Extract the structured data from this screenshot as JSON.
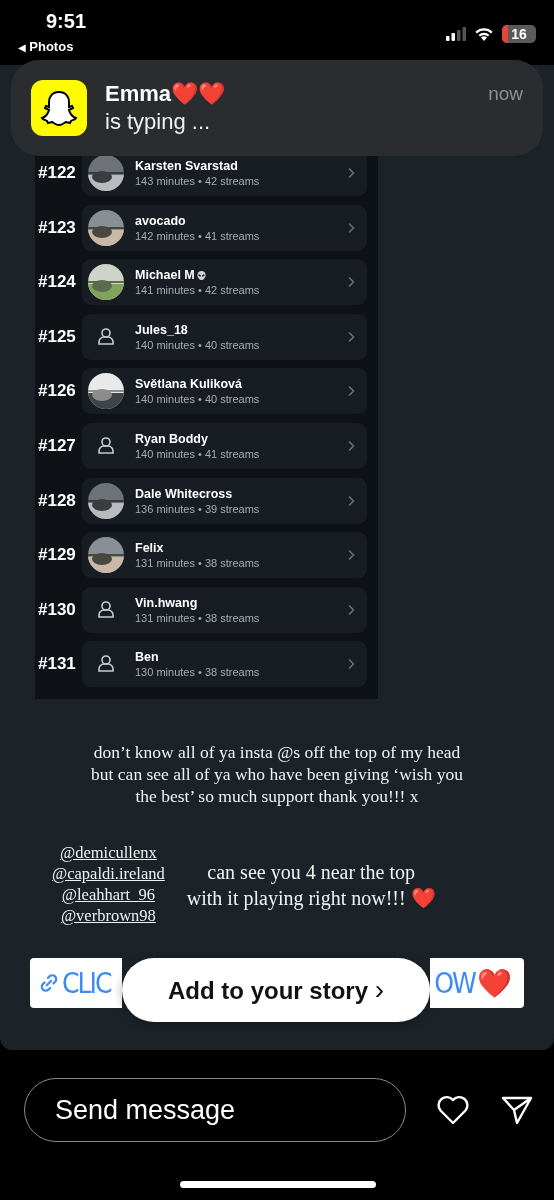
{
  "status_bar": {
    "time": "9:51",
    "back_arrow": "◀",
    "back_label": "Photos",
    "battery": "16"
  },
  "notification": {
    "name": "Emma",
    "emoji": "❤️❤️",
    "message": "is typing ...",
    "time": "now"
  },
  "leaderboard": [
    {
      "rank": "#122",
      "name": "Karsten Svarstad",
      "stats": "143 minutes • 42 streams",
      "alien_badge": false
    },
    {
      "rank": "#123",
      "name": "avocado",
      "stats": "142 minutes • 41 streams",
      "alien_badge": false
    },
    {
      "rank": "#124",
      "name": "Michael M",
      "stats": "141 minutes • 42 streams",
      "alien_badge": true
    },
    {
      "rank": "#125",
      "name": "Jules_18",
      "stats": "140 minutes • 40 streams",
      "kind": "placeholder",
      "alien_badge": false
    },
    {
      "rank": "#126",
      "name": "Světlana Kuliková",
      "stats": "140 minutes • 40 streams",
      "alien_badge": false
    },
    {
      "rank": "#127",
      "name": "Ryan Boddy",
      "stats": "140 minutes • 41 streams",
      "kind": "placeholder",
      "alien_badge": false
    },
    {
      "rank": "#128",
      "name": "Dale Whitecross",
      "stats": "136 minutes • 39 streams",
      "alien_badge": false
    },
    {
      "rank": "#129",
      "name": "Felix",
      "stats": "131 minutes • 38 streams",
      "alien_badge": false
    },
    {
      "rank": "#130",
      "name": "Vin.hwang",
      "stats": "131 minutes • 38 streams",
      "kind": "placeholder",
      "alien_badge": false
    },
    {
      "rank": "#131",
      "name": "Ben",
      "stats": "130 minutes • 38 streams",
      "kind": "placeholder",
      "alien_badge": false
    }
  ],
  "caption": {
    "lines": [
      "don’t know all of ya insta @s off the top of my head",
      "but can see all of ya who have been giving ‘wish you",
      "the best’ so much support thank you!!! x"
    ]
  },
  "mentions": [
    "@demicullenx",
    "@capaldi.ireland",
    "@leahhart_96",
    "@verbrown98"
  ],
  "side_note": {
    "lines": [
      "can see you 4 near the top",
      "with it playing right now!!!"
    ],
    "emoji": "❤️"
  },
  "link_sticker": {
    "text_left": "CLIC",
    "text_right": "OW",
    "emoji": "❤️"
  },
  "add_to_story": {
    "label": "Add to your story",
    "chevron": "›"
  },
  "reply_bar": {
    "placeholder": "Send message"
  }
}
